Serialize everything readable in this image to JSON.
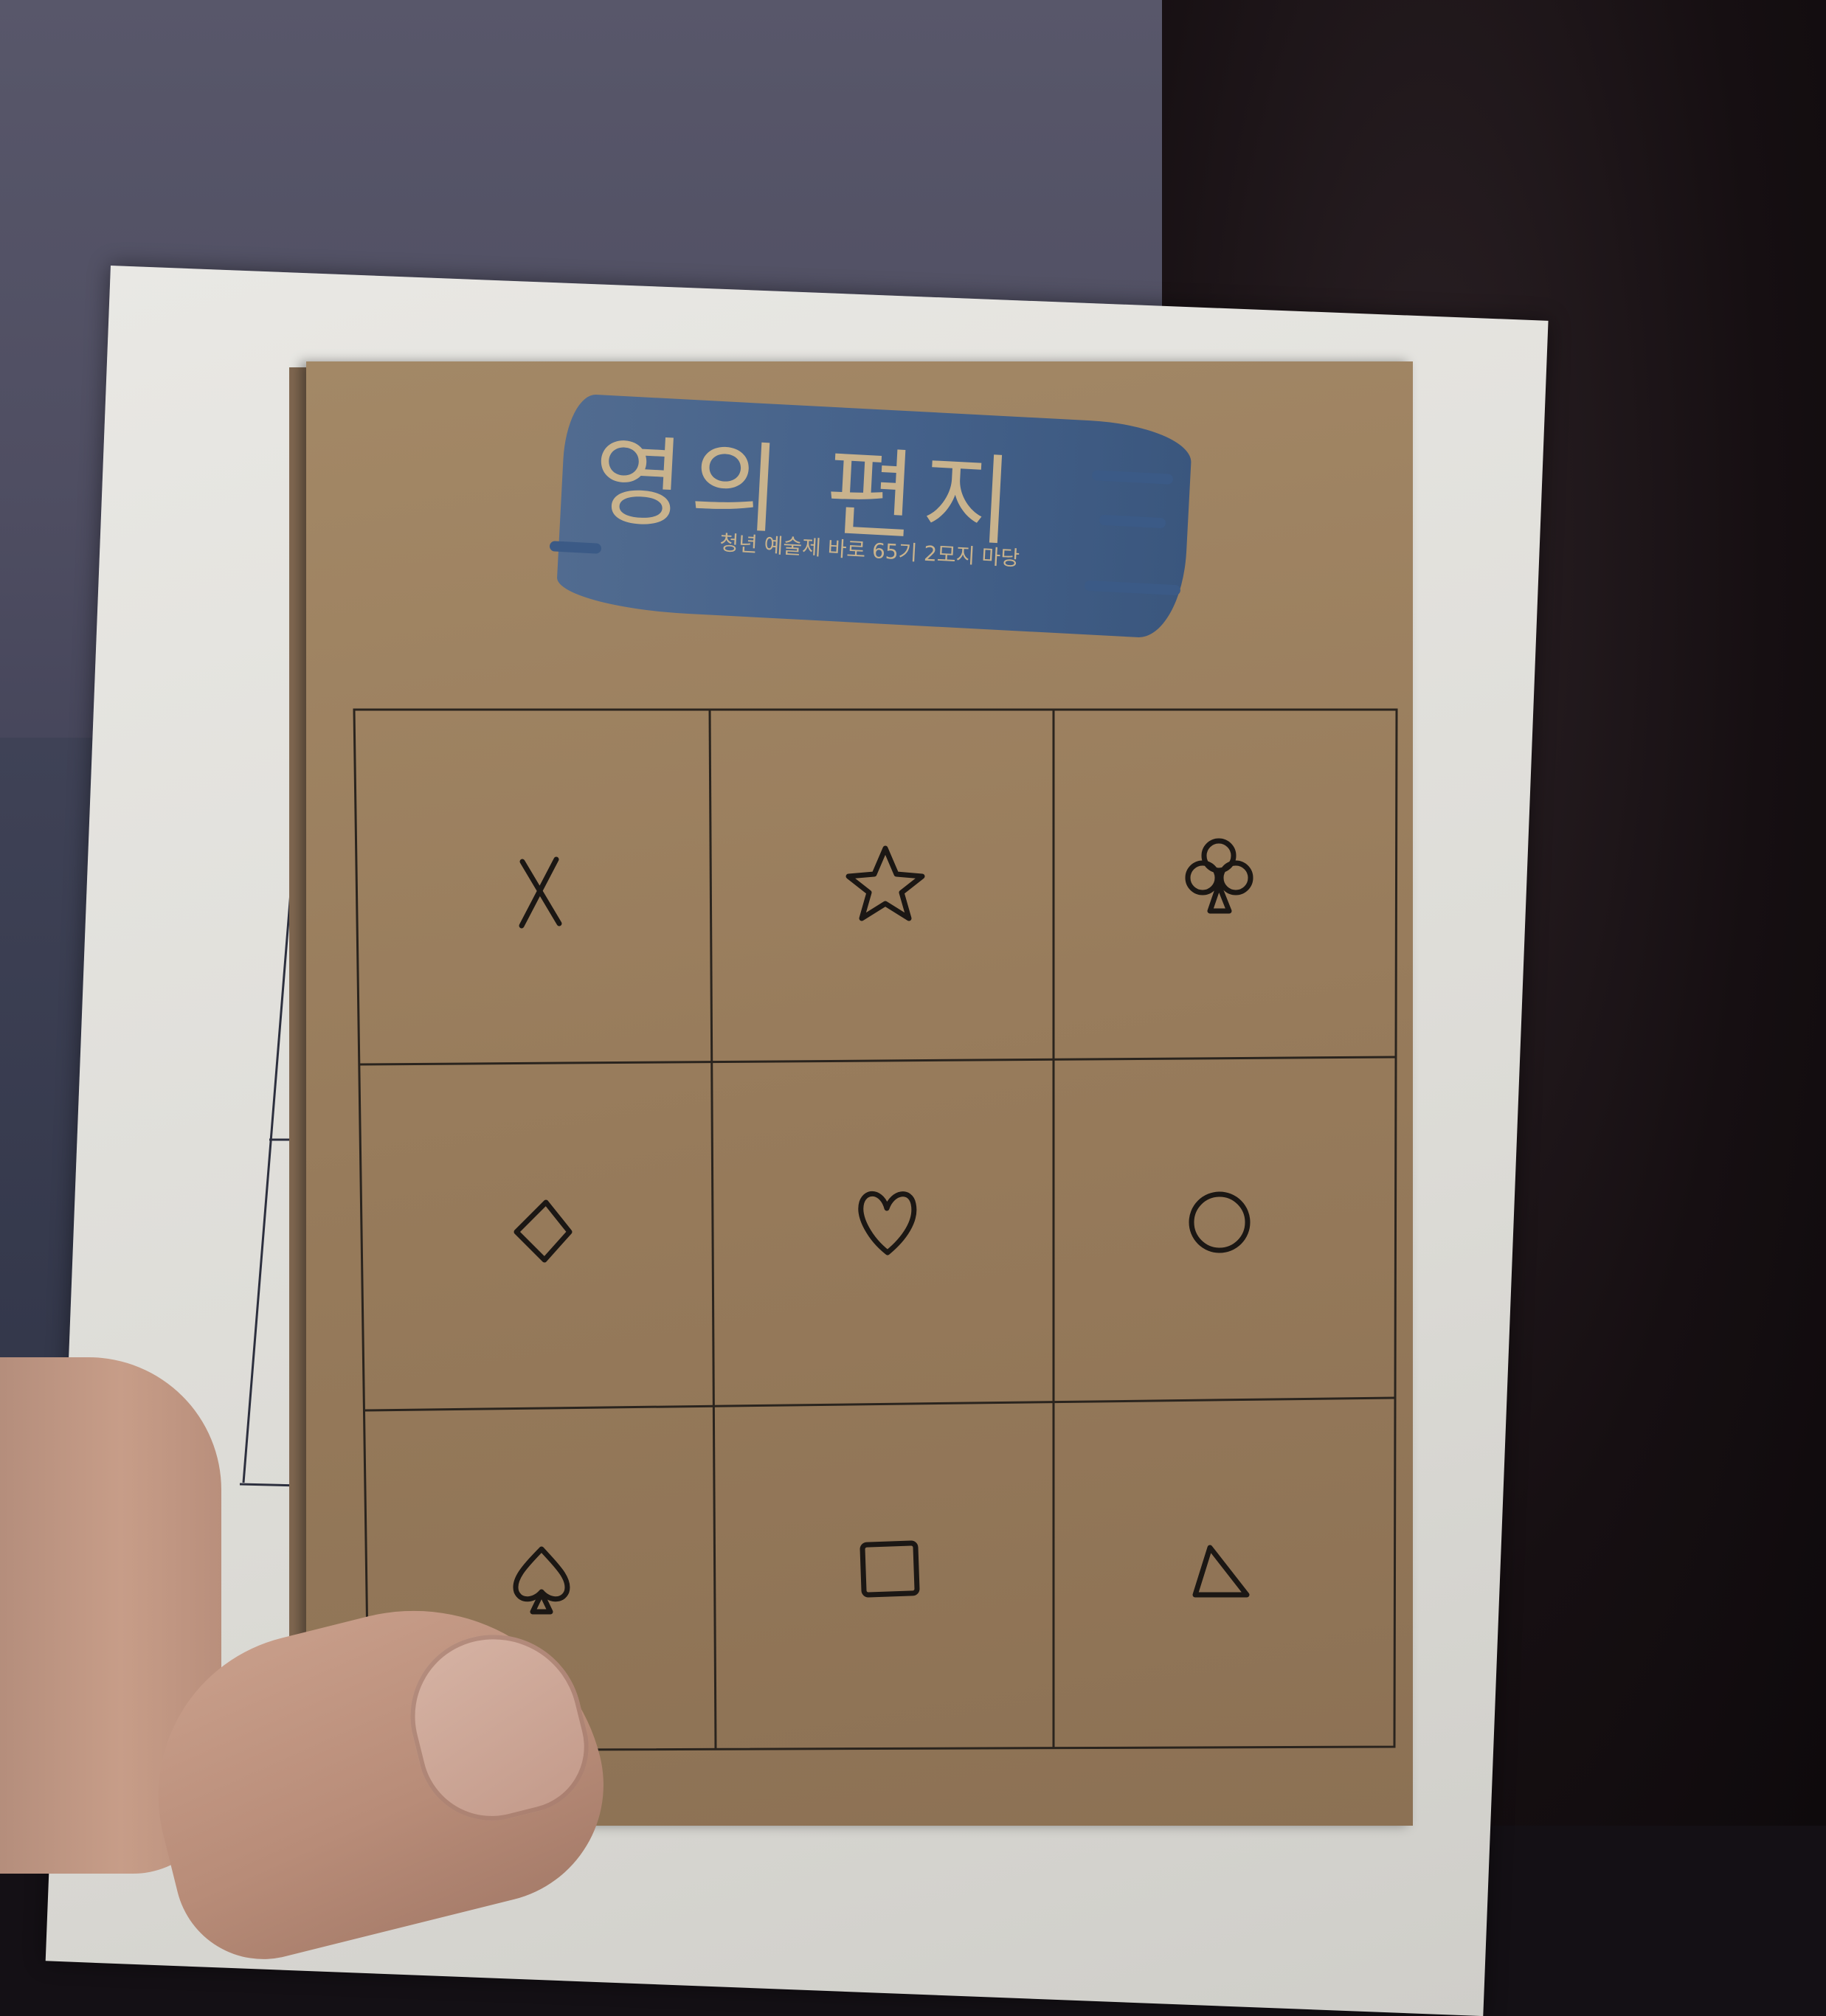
{
  "card": {
    "title": "영의 편지",
    "subtitle": "청년 예술제 바로 65기 2모지 마당"
  },
  "grid_symbols": [
    [
      "x-mark",
      "star",
      "club"
    ],
    [
      "diamond",
      "heart",
      "circle"
    ],
    [
      "spade",
      "square",
      "triangle"
    ]
  ],
  "colors": {
    "kraft_card": "#977b5b",
    "brush_blue": "#3f5f8c",
    "title_gold": "#c9b38d",
    "ink": "#1b1714"
  }
}
